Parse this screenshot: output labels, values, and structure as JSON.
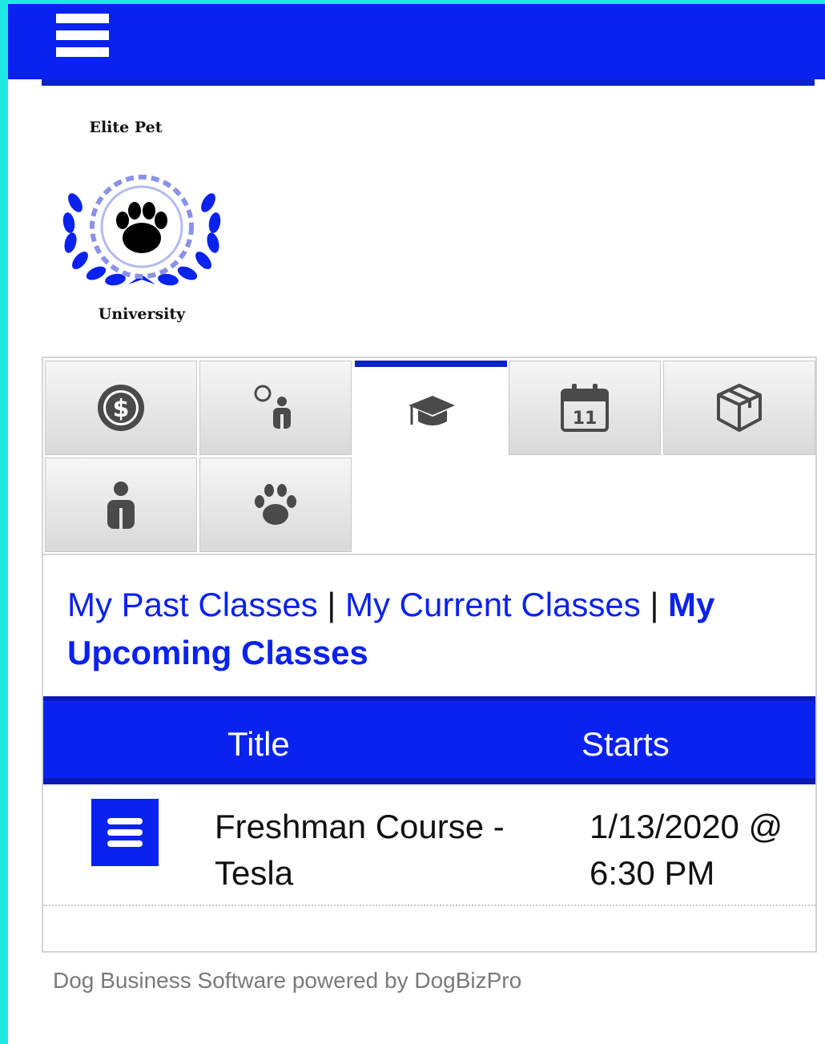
{
  "logo": {
    "top_text": "Elite Pet",
    "bottom_text": "University"
  },
  "tabs": [
    {
      "icon": "dollar-coin-icon"
    },
    {
      "icon": "person-search-icon"
    },
    {
      "icon": "graduation-cap-icon",
      "active": true
    },
    {
      "icon": "calendar-icon",
      "day": "11"
    },
    {
      "icon": "package-box-icon"
    },
    {
      "icon": "person-icon"
    },
    {
      "icon": "paw-print-icon"
    }
  ],
  "class_links": {
    "past": "My Past Classes",
    "separator": "|",
    "current": "My Current Classes",
    "upcoming": "My Upcoming Classes"
  },
  "table": {
    "headers": {
      "title": "Title",
      "starts": "Starts"
    },
    "rows": [
      {
        "title": "Freshman Course - Tesla",
        "starts": "1/13/2020 @ 6:30 PM"
      }
    ]
  },
  "footer": "Dog Business Software powered by DogBizPro",
  "colors": {
    "brand_blue": "#0a22f0",
    "accent_cyan": "#1ee8e4"
  }
}
